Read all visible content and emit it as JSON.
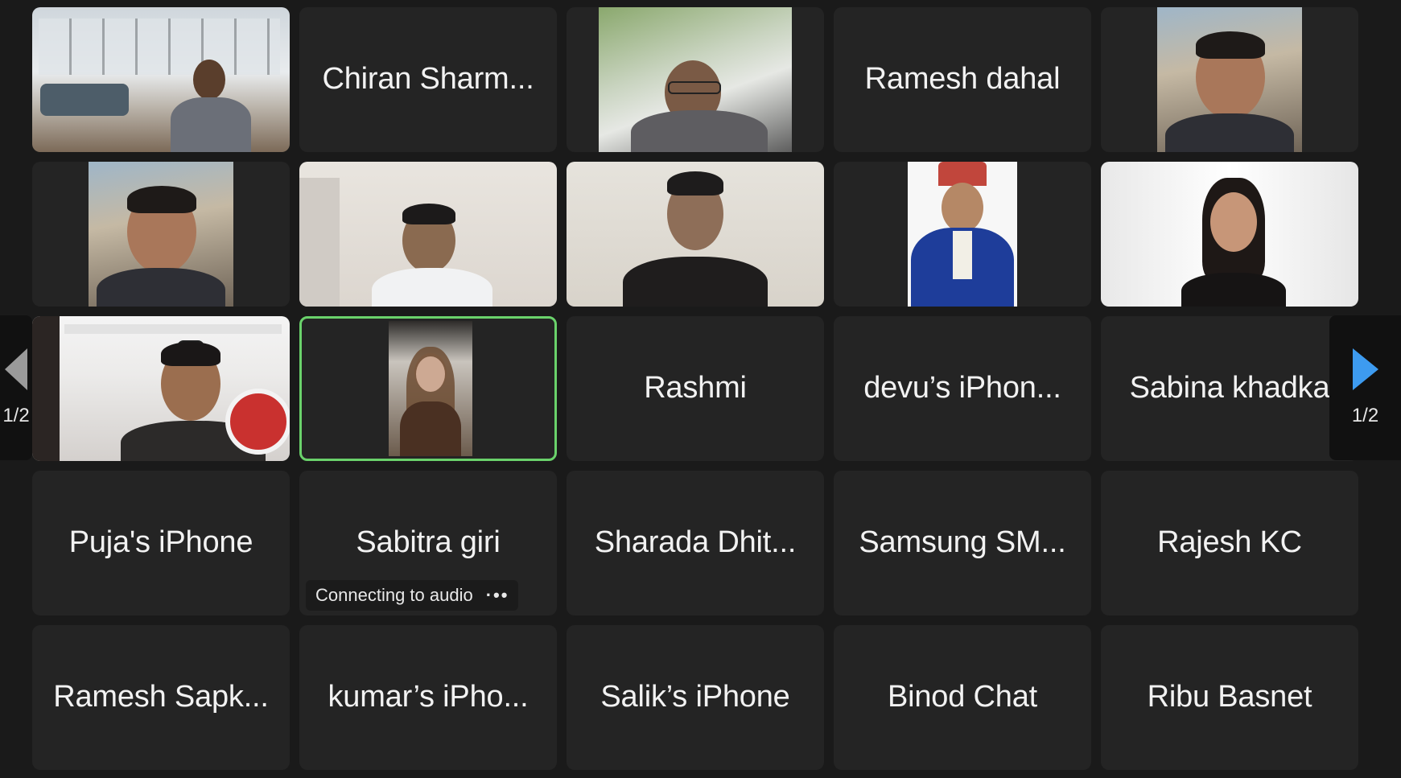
{
  "pagination": {
    "left_page": "1/2",
    "right_page": "1/2"
  },
  "tiles": [
    {
      "label": ""
    },
    {
      "label": "Chiran Sharm..."
    },
    {
      "label": ""
    },
    {
      "label": "Ramesh dahal"
    },
    {
      "label": ""
    },
    {
      "label": ""
    },
    {
      "label": ""
    },
    {
      "label": ""
    },
    {
      "label": ""
    },
    {
      "label": ""
    },
    {
      "label": ""
    },
    {
      "label": ""
    },
    {
      "label": "Rashmi"
    },
    {
      "label": "devu’s iPhon..."
    },
    {
      "label": "Sabina khadka"
    },
    {
      "label": "Puja's iPhone"
    },
    {
      "label": "Sabitra giri",
      "status": "Connecting to audio"
    },
    {
      "label": "Sharada Dhit..."
    },
    {
      "label": "Samsung SM..."
    },
    {
      "label": "Rajesh KC"
    },
    {
      "label": "Ramesh Sapk..."
    },
    {
      "label": "kumar’s iPho..."
    },
    {
      "label": "Salik’s iPhone"
    },
    {
      "label": "Binod Chat"
    },
    {
      "label": "Ribu Basnet"
    }
  ],
  "colors": {
    "background": "#1a1a1a",
    "tile": "#242424",
    "active_border": "#6ad26b",
    "next_arrow": "#3d9bf0"
  }
}
